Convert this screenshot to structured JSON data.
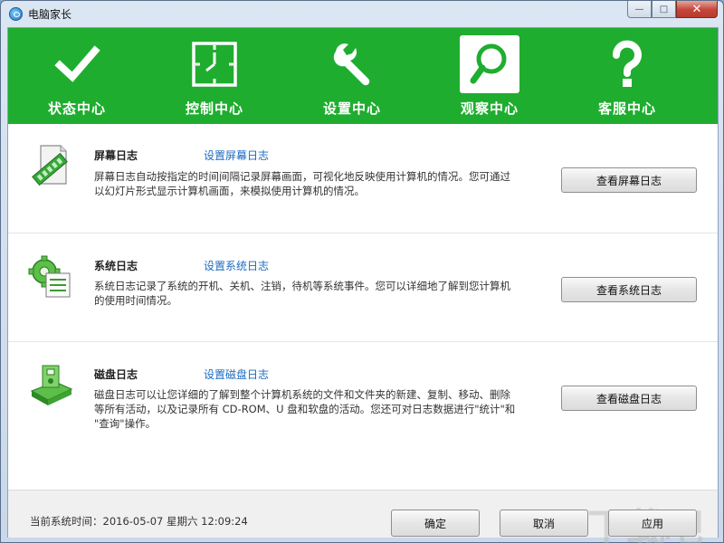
{
  "window": {
    "title": "电脑家长",
    "minimize_glyph": "—",
    "maximize_glyph": "□",
    "close_glyph": "✕"
  },
  "nav": {
    "items": [
      {
        "label": "状态中心",
        "icon": "checkmark-icon",
        "active": false
      },
      {
        "label": "控制中心",
        "icon": "clock-icon",
        "active": false
      },
      {
        "label": "设置中心",
        "icon": "wrench-icon",
        "active": false
      },
      {
        "label": "观察中心",
        "icon": "magnifier-icon",
        "active": true
      },
      {
        "label": "客服中心",
        "icon": "question-icon",
        "active": false
      }
    ],
    "color": "#1fad2f"
  },
  "sections": [
    {
      "title": "屏幕日志",
      "link": "设置屏幕日志",
      "desc_lines": [
        "屏幕日志自动按指定的时间间隔记录屏幕画面，可视化地反映使用计算机的情况。您可通过",
        "以幻灯片形式显示计算机画面，来模拟使用计算机的情况。"
      ],
      "button": "查看屏幕日志"
    },
    {
      "title": "系统日志",
      "link": "设置系统日志",
      "desc_lines": [
        "系统日志记录了系统的开机、关机、注销，待机等系统事件。您可以详细地了解到您计算机",
        "的使用时间情况。"
      ],
      "button": "查看系统日志"
    },
    {
      "title": "磁盘日志",
      "link": "设置磁盘日志",
      "desc_lines": [
        "磁盘日志可以让您详细的了解到整个计算机系统的文件和文件夹的新建、复制、移动、删除",
        "等所有活动，以及记录所有 CD-ROM、U 盘和软盘的活动。您还可对日志数据进行\"统计\"和",
        "\"查询\"操作。"
      ],
      "button": "查看磁盘日志"
    }
  ],
  "footer": {
    "time_label": "当前系统时间：2016-05-07 星期六  12:09:24",
    "ok": "确定",
    "cancel": "取消",
    "apply": "应用",
    "watermark": "下载吧"
  },
  "colors": {
    "link": "#1b6bc0",
    "accent": "#1fad2f"
  }
}
